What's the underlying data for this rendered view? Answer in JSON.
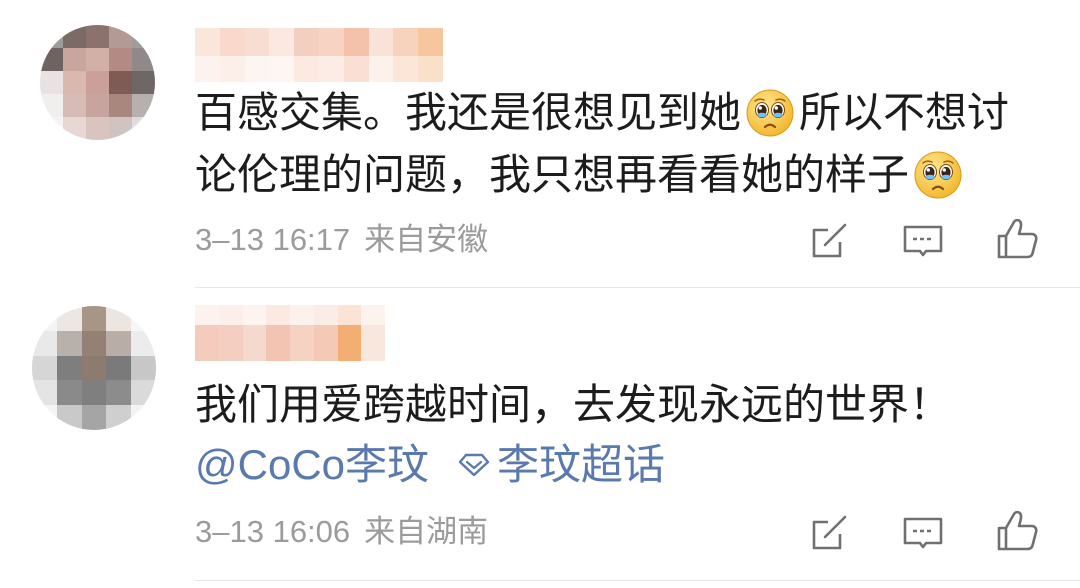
{
  "colors": {
    "background": "#ffffff",
    "text": "#1c1c1c",
    "meta": "#9b9b9b",
    "link": "#5a79ad",
    "icon": "#707070",
    "divider": "#e8e8e8"
  },
  "icons": {
    "repost": "pencil-square-icon",
    "comment": "speech-bubble-icon",
    "like": "thumbs-up-icon",
    "topic": "diamond-icon",
    "emoji": "crying-face-icon"
  },
  "comments": [
    {
      "lines": [
        {
          "before_emoji": "百感交集。我还是很想见到她",
          "after_emoji": "所以不想讨"
        },
        {
          "before_emoji": "论伦理的问题，我只想再看看她的样子"
        }
      ],
      "date": "3–13 16:17",
      "source": "来自安徽"
    },
    {
      "lines": [
        {
          "text": "我们用爱跨越时间，去发现永远的世界！"
        }
      ],
      "mention": "@CoCo李玟",
      "topic": "李玟超话",
      "date": "3–13 16:06",
      "source": "来自湖南"
    }
  ]
}
